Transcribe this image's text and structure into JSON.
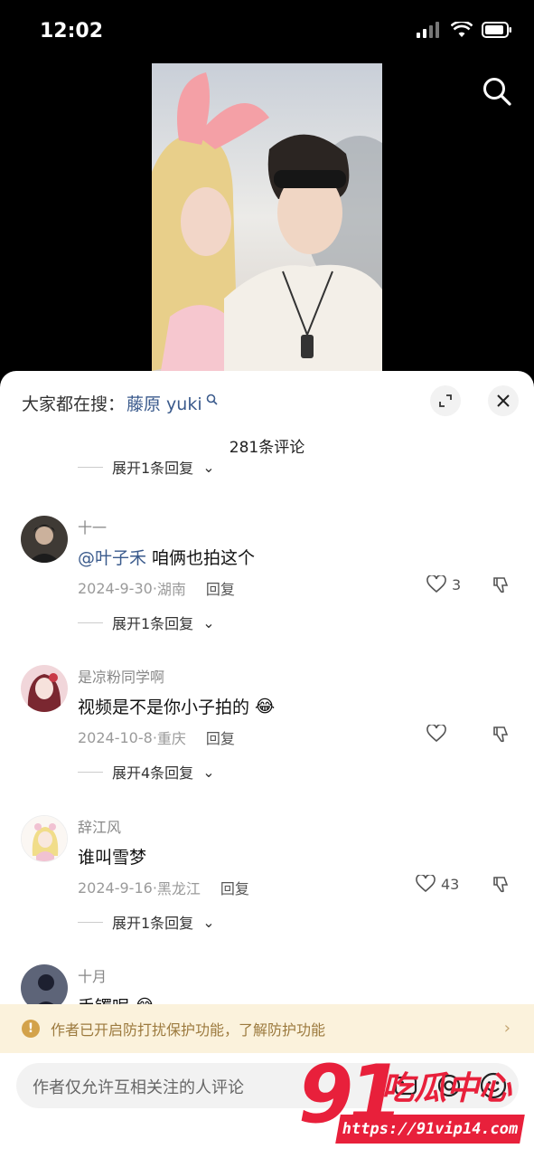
{
  "status_bar": {
    "time": "12:02"
  },
  "hot_search": {
    "prefix": "大家都在搜：",
    "keyword": "藤原 yuki"
  },
  "comment_count": "281条评论",
  "partial_expand": "展开1条回复",
  "comments": [
    {
      "username": "十一",
      "mention": "@叶子禾",
      "text": "咱俩也拍这个",
      "emoji": "",
      "date": "2024-9-30",
      "location": "湖南",
      "reply_label": "回复",
      "likes": "3",
      "expand": "展开1条回复"
    },
    {
      "username": "是凉粉同学啊",
      "mention": "",
      "text": "视频是不是你小子拍的",
      "emoji": "😂",
      "date": "2024-10-8",
      "location": "重庆",
      "reply_label": "回复",
      "likes": "",
      "expand": "展开4条回复"
    },
    {
      "username": "辞江风",
      "mention": "",
      "text": "谁叫雪梦",
      "emoji": "",
      "date": "2024-9-16",
      "location": "黑龙江",
      "reply_label": "回复",
      "likes": "43",
      "expand": "展开1条回复"
    },
    {
      "username": "十月",
      "mention": "",
      "text": "手镯呢",
      "emoji": "😂"
    }
  ],
  "notice": {
    "text": "作者已开启防打扰保护功能，了解防护功能"
  },
  "input": {
    "placeholder": "作者仅允许互相关注的人评论"
  },
  "watermark": {
    "big": "91",
    "cn": "吃瓜中心",
    "url": "https://91vip14.com"
  },
  "colors": {
    "accent_link": "#3a5a8c",
    "watermark": "#e8203b",
    "notice_bg": "#fbf2dc"
  }
}
